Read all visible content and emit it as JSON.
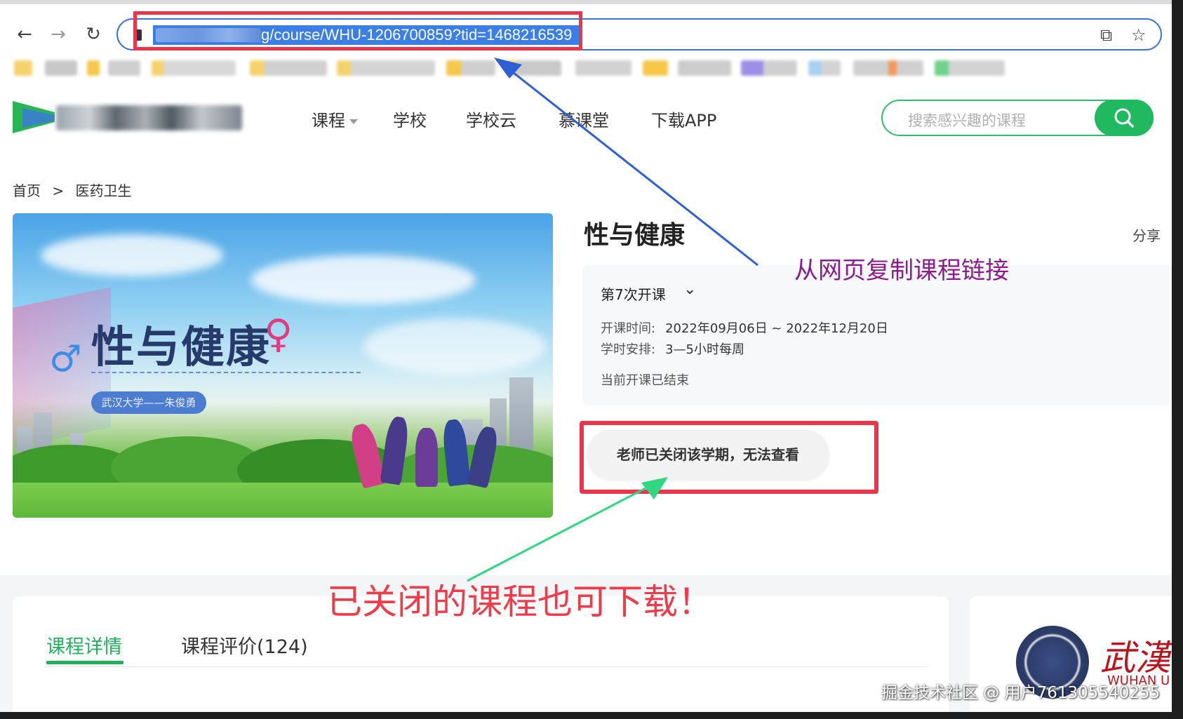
{
  "browser": {
    "url_visible": "g/course/WHU-1206700859?tid=1468216539",
    "back_icon": "arrow-left-icon",
    "forward_icon": "arrow-right-icon",
    "reload_icon": "reload-icon",
    "share_icon": "share-page-icon",
    "bookmark_icon": "star-icon"
  },
  "header": {
    "nav": [
      "课程",
      "学校",
      "学校云",
      "慕课堂",
      "下载APP"
    ],
    "search_placeholder": "搜索感兴趣的课程",
    "search_icon": "search-icon"
  },
  "breadcrumb": {
    "home": "首页",
    "sep": ">",
    "category": "医药卫生"
  },
  "banner": {
    "title": "性与健康",
    "pill": "武汉大学——朱俊勇",
    "male_symbol": "♂",
    "female_symbol": "♀"
  },
  "course": {
    "title": "性与健康",
    "share": "分享",
    "term": "第7次开课",
    "time_label": "开课时间:",
    "time_value": "2022年09月06日 ~ 2022年12月20日",
    "hours_label": "学时安排:",
    "hours_value": "3—5小时每周",
    "status": "当前开课已结束",
    "closed_button": "老师已关闭该学期，无法查看"
  },
  "annotations": {
    "copy_link": "从网页复制课程链接",
    "closed_download": "已关闭的课程也可下载！"
  },
  "tabs": {
    "detail": "课程详情",
    "reviews": "课程评价(124)"
  },
  "school": {
    "name_cn": "武漢",
    "name_en": "WUHAN U"
  },
  "watermark": "掘金技术社区 @ 用户761305540255",
  "colors": {
    "accent_green": "#21b95f",
    "highlight_red": "#e8374d",
    "arrow_blue": "#2f5fd6",
    "arrow_green": "#2fd783"
  }
}
